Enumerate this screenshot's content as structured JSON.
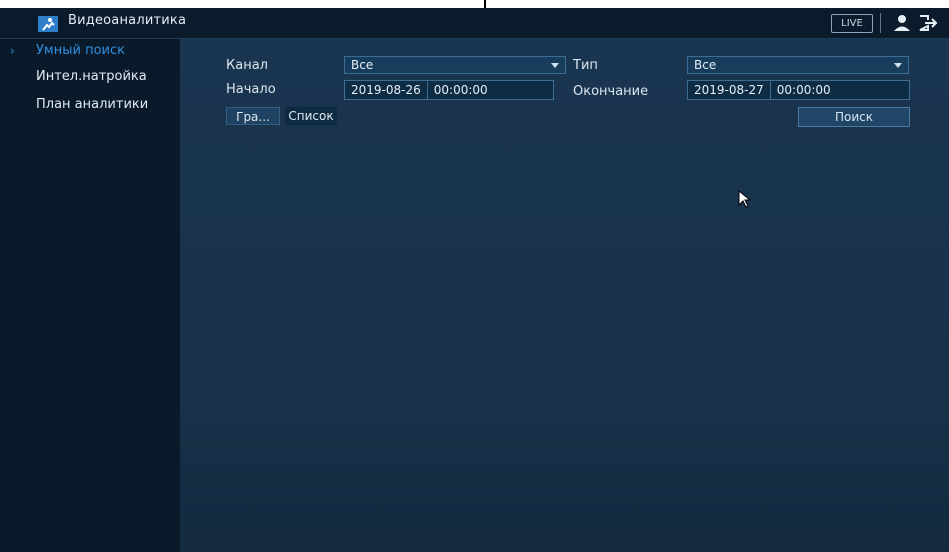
{
  "header": {
    "title": "Видеоаналитика",
    "live_label": "LIVE",
    "app_icon": "analytics-icon",
    "user_icon": "user-icon",
    "exit_icon": "logout-icon"
  },
  "sidebar": {
    "items": [
      {
        "label": "Умный поиск",
        "active": true
      },
      {
        "label": "Интел.натройка",
        "active": false
      },
      {
        "label": "План аналитики",
        "active": false
      }
    ]
  },
  "form": {
    "channel_label": "Канал",
    "channel_value": "Все",
    "type_label": "Тип",
    "type_value": "Все",
    "start_label": "Начало",
    "start_date": "2019-08-26",
    "start_time": "00:00:00",
    "end_label": "Окончание",
    "end_date": "2019-08-27",
    "end_time": "00:00:00"
  },
  "view_tabs": {
    "graph_label": "Гра...",
    "list_label": "Список"
  },
  "search_button": "Поиск",
  "colors": {
    "accent": "#2e8fe0",
    "background": "#1a3550",
    "sidebar": "#0a1a2a"
  }
}
